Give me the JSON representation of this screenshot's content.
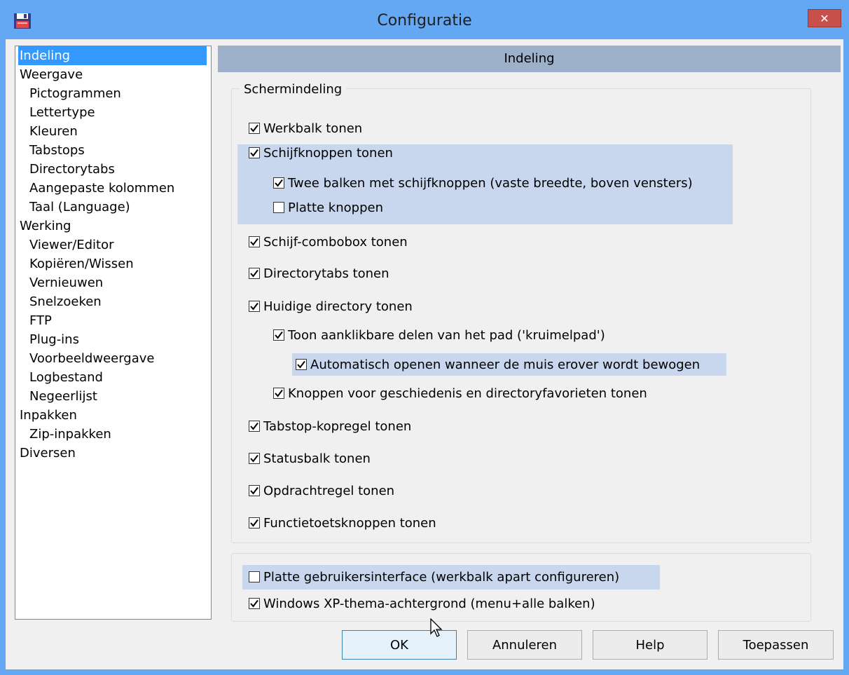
{
  "window": {
    "title": "Configuratie",
    "close_symbol": "✕"
  },
  "tree": {
    "items": [
      {
        "label": "Indeling",
        "level": 0,
        "selected": true
      },
      {
        "label": "Weergave",
        "level": 0
      },
      {
        "label": "Pictogrammen",
        "level": 1
      },
      {
        "label": "Lettertype",
        "level": 1
      },
      {
        "label": "Kleuren",
        "level": 1
      },
      {
        "label": "Tabstops",
        "level": 1
      },
      {
        "label": "Directorytabs",
        "level": 1
      },
      {
        "label": "Aangepaste kolommen",
        "level": 1
      },
      {
        "label": "Taal (Language)",
        "level": 1
      },
      {
        "label": "Werking",
        "level": 0
      },
      {
        "label": "Viewer/Editor",
        "level": 1
      },
      {
        "label": "Kopiëren/Wissen",
        "level": 1
      },
      {
        "label": "Vernieuwen",
        "level": 1
      },
      {
        "label": "Snelzoeken",
        "level": 1
      },
      {
        "label": "FTP",
        "level": 1
      },
      {
        "label": "Plug-ins",
        "level": 1
      },
      {
        "label": "Voorbeeldweergave",
        "level": 1
      },
      {
        "label": "Logbestand",
        "level": 1
      },
      {
        "label": "Negeerlijst",
        "level": 1
      },
      {
        "label": "Inpakken",
        "level": 0
      },
      {
        "label": "Zip-inpakken",
        "level": 1
      },
      {
        "label": "Diversen",
        "level": 0
      }
    ]
  },
  "panel": {
    "header": "Indeling"
  },
  "group1": {
    "label": "Schermindeling",
    "options": [
      {
        "label": "Werkbalk tonen",
        "checked": true
      },
      {
        "label": "Schijfknoppen tonen",
        "checked": true
      },
      {
        "label": "Twee balken met schijfknoppen (vaste breedte, boven vensters)",
        "checked": true
      },
      {
        "label": "Platte knoppen",
        "checked": false
      },
      {
        "label": "Schijf-combobox tonen",
        "checked": true
      },
      {
        "label": "Directorytabs tonen",
        "checked": true
      },
      {
        "label": "Huidige directory tonen",
        "checked": true
      },
      {
        "label": "Toon aanklikbare delen van het pad ('kruimelpad')",
        "checked": true
      },
      {
        "label": "Automatisch openen wanneer de muis erover wordt bewogen",
        "checked": true
      },
      {
        "label": "Knoppen voor geschiedenis en directoryfavorieten tonen",
        "checked": true
      },
      {
        "label": "Tabstop-kopregel tonen",
        "checked": true
      },
      {
        "label": "Statusbalk tonen",
        "checked": true
      },
      {
        "label": "Opdrachtregel tonen",
        "checked": true
      },
      {
        "label": "Functietoetsknoppen tonen",
        "checked": true
      }
    ]
  },
  "group2": {
    "options": [
      {
        "label": "Platte gebruikersinterface (werkbalk apart configureren)",
        "checked": false
      },
      {
        "label": "Windows XP-thema-achtergrond (menu+alle balken)",
        "checked": true
      }
    ]
  },
  "buttons": {
    "ok": "OK",
    "cancel": "Annuleren",
    "help": "Help",
    "apply": "Toepassen"
  },
  "colors": {
    "titlebar": "#64a7f2",
    "selection": "#3399ff",
    "highlight": "#c8d6ee",
    "header": "#9cb0c9",
    "close": "#c7504b"
  }
}
